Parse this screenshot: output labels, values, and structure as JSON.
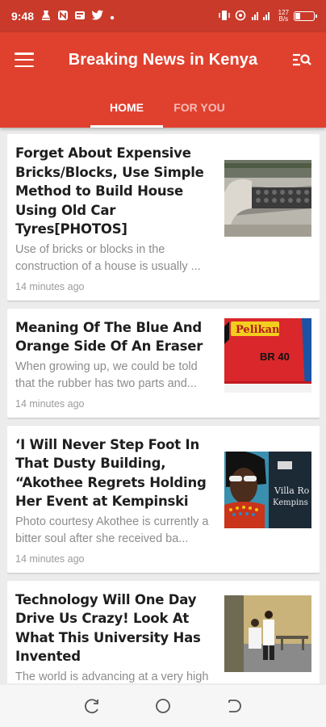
{
  "status_bar": {
    "time": "9:48",
    "net_speed_value": "127",
    "net_speed_unit": "B/s"
  },
  "app_bar": {
    "title": "Breaking News in Kenya",
    "tabs": [
      {
        "label": "HOME",
        "active": true
      },
      {
        "label": "FOR YOU",
        "active": false
      }
    ]
  },
  "articles": [
    {
      "title": "Forget About Expensive Bricks/Blocks, Use Simple Method to Build House Using Old Car Tyres[PHOTOS]",
      "excerpt": "Use of bricks or blocks in the construction of a house is usually ...",
      "time": "14 minutes ago"
    },
    {
      "title": "Meaning Of The Blue And Orange Side Of An Eraser",
      "excerpt": "When growing up, we could be told that the rubber has two parts and...",
      "time": "14 minutes ago",
      "thumb_text": {
        "brand": "Pelikan",
        "code": "BR 40"
      }
    },
    {
      "title": "‘I Will Never Step Foot In That Dusty Building, “Akothee Regrets Holding Her Event at Kempinski",
      "excerpt": "Photo courtesy Akothee is currently a bitter soul after she received ba...",
      "time": "14 minutes ago",
      "thumb_text": {
        "line1": "Villa Ro",
        "line2": "Kempins"
      }
    },
    {
      "title": "Technology Will One Day Drive Us Crazy! Look At What This University Has Invented",
      "excerpt": "The world is advancing at a very high speed. Technology is lea...",
      "time": ""
    }
  ],
  "colors": {
    "status_bar": "#c93a2b",
    "app_bar": "#e0412f",
    "title_text": "#1e1e1e",
    "meta_text": "#8c8c8c"
  }
}
